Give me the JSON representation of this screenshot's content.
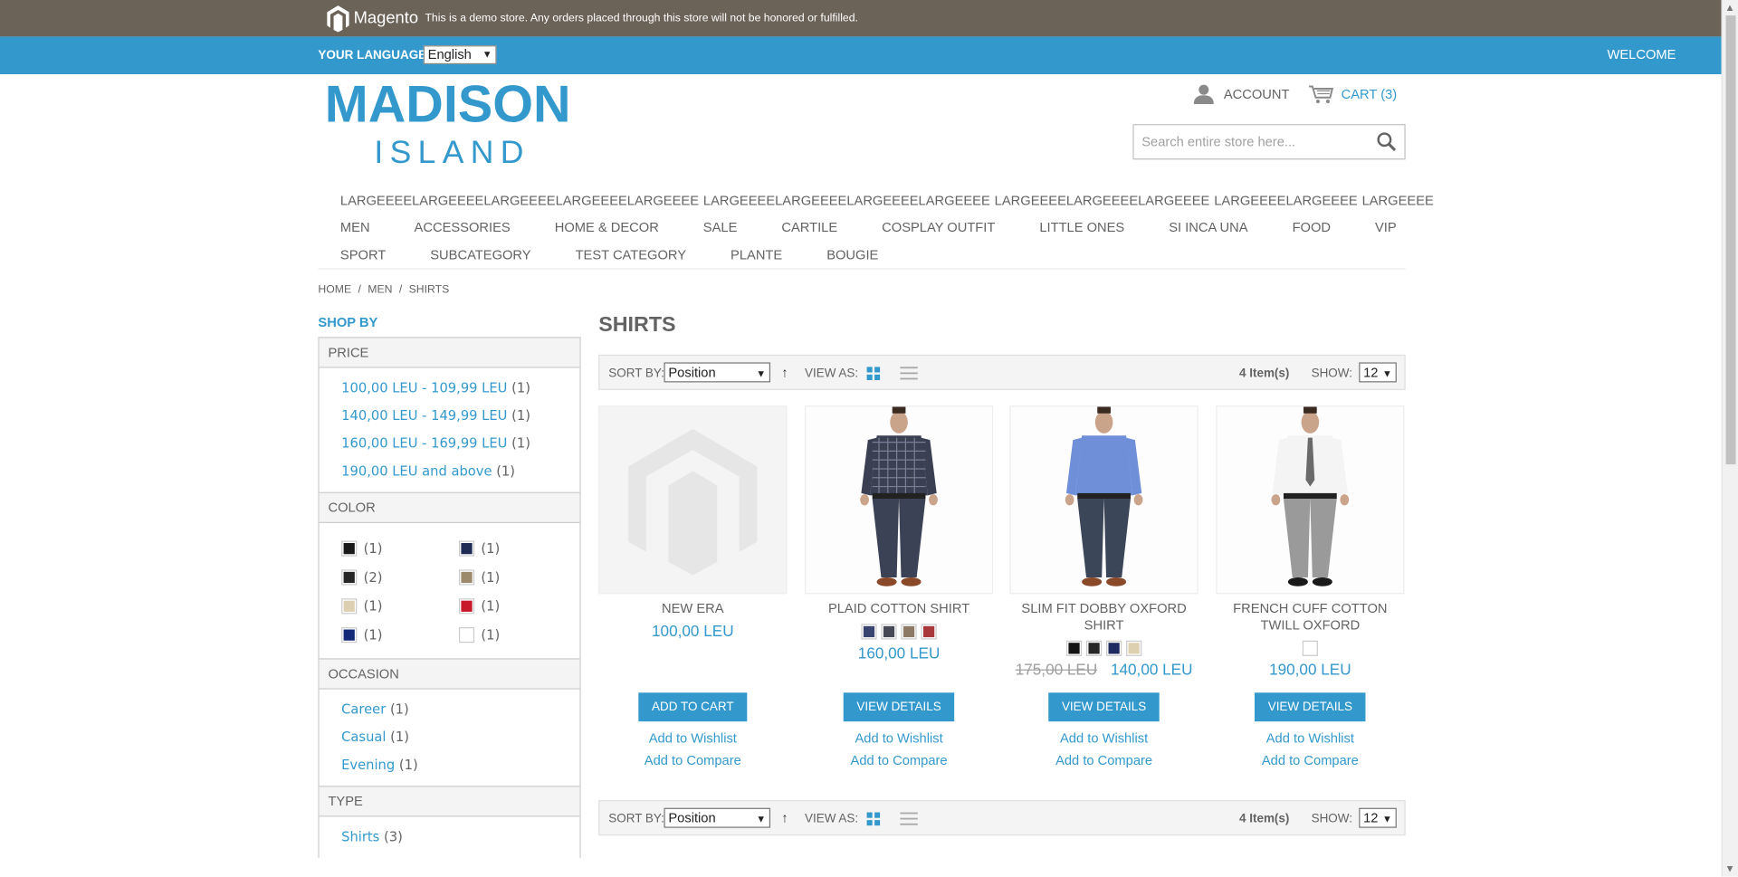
{
  "demo_bar": {
    "logo_text": "Magento",
    "notice": "This is a demo store. Any orders placed through this store will not be honored or fulfilled."
  },
  "lang_bar": {
    "label": "YOUR LANGUAGE:",
    "selected_language": "English",
    "welcome": "WELCOME"
  },
  "header": {
    "logo_main": "MADISON",
    "logo_sub": "ISLAND",
    "account_label": "ACCOUNT",
    "cart_label": "CART (3)",
    "search_placeholder": "Search entire store here..."
  },
  "nav": {
    "row1": [
      "LARGEEEELARGEEEELARGEEEELARGEEEELARGEEEE",
      "LARGEEEELARGEEEELARGEEEELARGEEEE",
      "LARGEEEELARGEEEELARGEEEE",
      "LARGEEEELARGEEEE",
      "LARGEEEE"
    ],
    "row2": [
      "MEN",
      "ACCESSORIES",
      "HOME & DECOR",
      "SALE",
      "CARTILE",
      "COSPLAY OUTFIT",
      "LITTLE ONES",
      "SI INCA UNA",
      "FOOD",
      "VIP"
    ],
    "row3": [
      "SPORT",
      "SUBCATEGORY",
      "TEST CATEGORY",
      "PLANTE",
      "BOUGIE"
    ]
  },
  "breadcrumbs": [
    "HOME",
    "MEN",
    "SHIRTS"
  ],
  "sidebar": {
    "shop_by": "SHOP BY",
    "price": {
      "title": "PRICE",
      "items": [
        {
          "label": "100,00 LEU - 109,99 LEU",
          "count": "(1)"
        },
        {
          "label": "140,00 LEU - 149,99 LEU",
          "count": "(1)"
        },
        {
          "label": "160,00 LEU - 169,99 LEU",
          "count": "(1)"
        },
        {
          "label": "190,00 LEU and above",
          "count": "(1)"
        }
      ]
    },
    "color": {
      "title": "COLOR",
      "items": [
        {
          "color": "#1a1a1a",
          "count": "(1)"
        },
        {
          "color": "#1f2a55",
          "count": "(1)"
        },
        {
          "color": "#262626",
          "count": "(2)"
        },
        {
          "color": "#9c8a6c",
          "count": "(1)"
        },
        {
          "color": "#ddd0b0",
          "count": "(1)"
        },
        {
          "color": "#c8192a",
          "count": "(1)"
        },
        {
          "color": "#142a78",
          "count": "(1)"
        },
        {
          "color": "#ffffff",
          "count": "(1)"
        }
      ]
    },
    "occasion": {
      "title": "OCCASION",
      "items": [
        {
          "label": "Career",
          "count": "(1)"
        },
        {
          "label": "Casual",
          "count": "(1)"
        },
        {
          "label": "Evening",
          "count": "(1)"
        }
      ]
    },
    "type": {
      "title": "TYPE",
      "items": [
        {
          "label": "Shirts",
          "count": "(3)"
        }
      ]
    }
  },
  "main": {
    "title": "SHIRTS",
    "toolbar": {
      "sort_label": "SORT BY:",
      "sort_value": "Position",
      "view_label": "VIEW AS:",
      "count": "4 Item(s)",
      "show_label": "SHOW:",
      "show_value": "12"
    },
    "products": [
      {
        "name": "NEW ERA",
        "price": "100,00 LEU",
        "button": "ADD TO CART",
        "wishlist": "Add to Wishlist",
        "compare": "Add to Compare",
        "image": "placeholder",
        "swatches": []
      },
      {
        "name": "PLAID COTTON SHIRT",
        "price": "160,00 LEU",
        "button": "VIEW DETAILS",
        "wishlist": "Add to Wishlist",
        "compare": "Add to Compare",
        "image": "plaid",
        "swatches": [
          "#3a4470",
          "#474a55",
          "#8c7a66",
          "#a8383c"
        ]
      },
      {
        "name": "SLIM FIT DOBBY OXFORD SHIRT",
        "old_price": "175,00 LEU",
        "price": "140,00 LEU",
        "button": "VIEW DETAILS",
        "wishlist": "Add to Wishlist",
        "compare": "Add to Compare",
        "image": "blue",
        "swatches": [
          "#151515",
          "#262626",
          "#1f2a60",
          "#ddd0b0"
        ]
      },
      {
        "name": "FRENCH CUFF COTTON TWILL OXFORD",
        "price": "190,00 LEU",
        "button": "VIEW DETAILS",
        "wishlist": "Add to Wishlist",
        "compare": "Add to Compare",
        "image": "white",
        "swatches": [
          "#ffffff"
        ]
      }
    ]
  }
}
